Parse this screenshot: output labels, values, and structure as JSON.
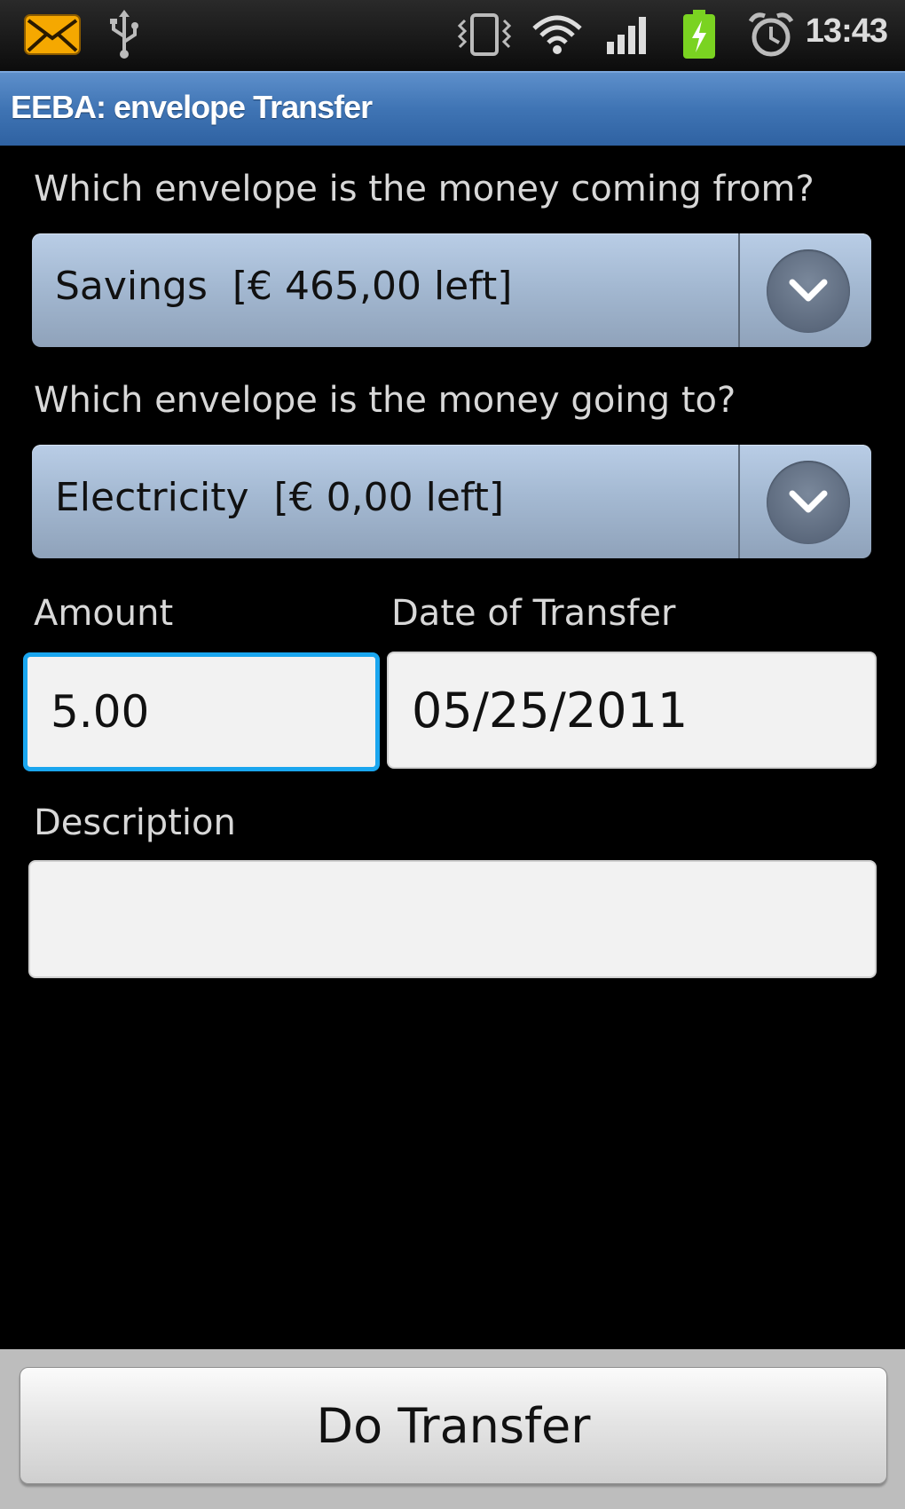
{
  "status_bar": {
    "time": "13:43",
    "icons": [
      "mail-icon",
      "usb-icon",
      "vibrate-icon",
      "wifi-icon",
      "signal-icon",
      "battery-charging-icon",
      "alarm-icon"
    ]
  },
  "app": {
    "title": "EEBA: envelope Transfer"
  },
  "form": {
    "from_label": "Which envelope is the money coming from?",
    "from_selected": "Savings  [€ 465,00 left]",
    "to_label": "Which envelope is the money going to?",
    "to_selected": "Electricity  [€ 0,00 left]",
    "amount_label": "Amount",
    "amount_value": "5.00",
    "date_label": "Date of Transfer",
    "date_value": "05/25/2011",
    "description_label": "Description",
    "description_value": ""
  },
  "actions": {
    "do_transfer_label": "Do Transfer"
  },
  "colors": {
    "title_bar": "#3f74b4",
    "focus_border": "#1aa6ef",
    "battery": "#7ad321",
    "mail": "#f5a800"
  }
}
